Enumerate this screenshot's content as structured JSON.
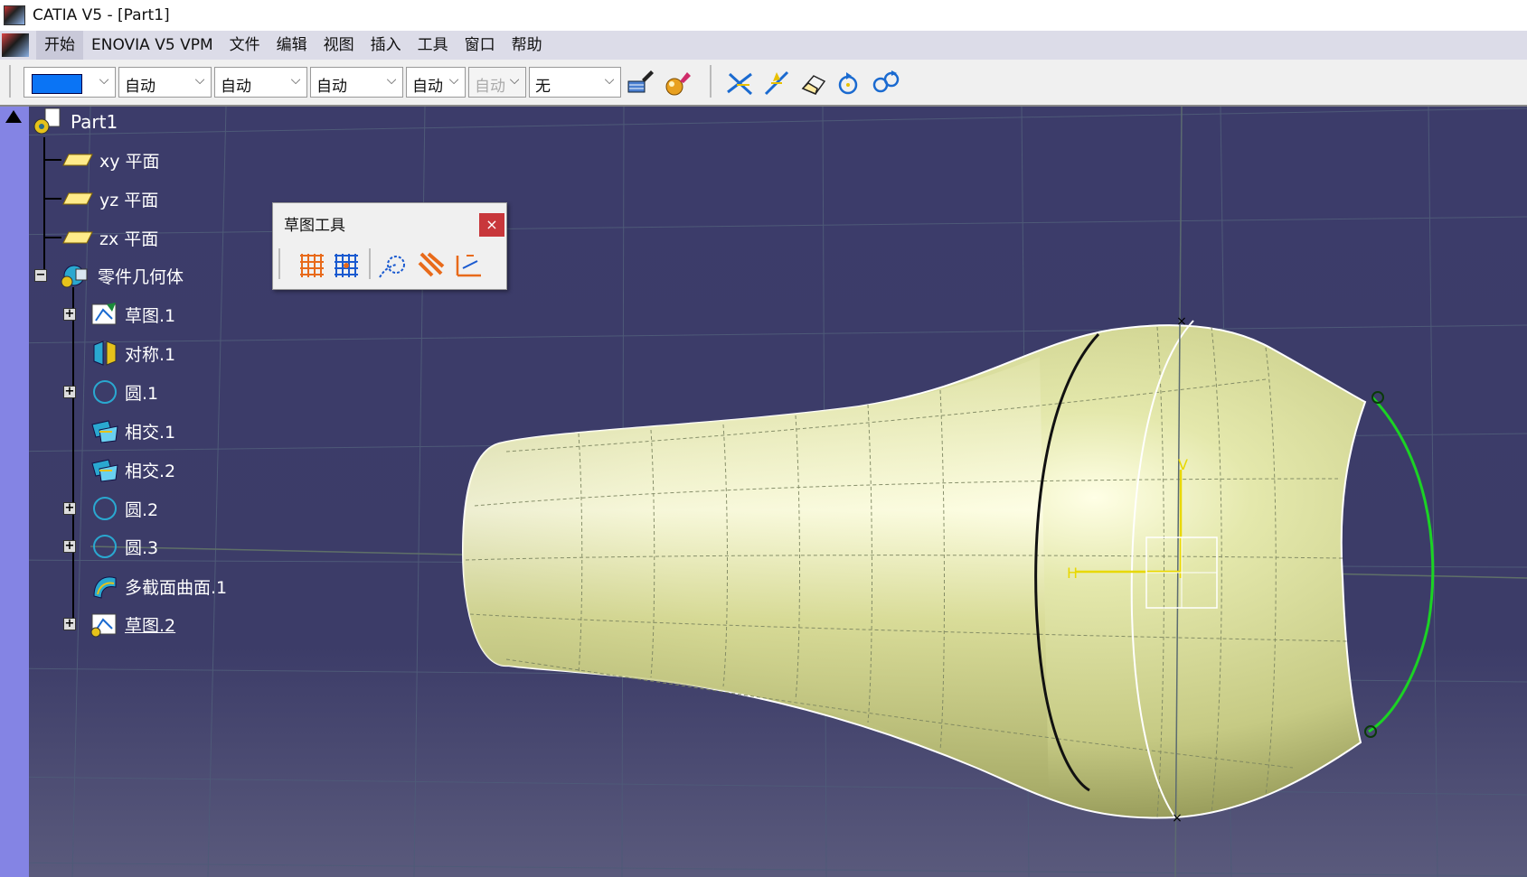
{
  "window": {
    "title": "CATIA V5 - [Part1]"
  },
  "menu": {
    "items": [
      "开始",
      "ENOVIA V5 VPM",
      "文件",
      "编辑",
      "视图",
      "插入",
      "工具",
      "窗口",
      "帮助"
    ]
  },
  "toolbar": {
    "color_value": "",
    "combo1": "自动",
    "combo2": "自动",
    "combo3": "自动",
    "combo4": "自动",
    "combo5": "自动",
    "combo6": "无",
    "accent_color": "#0a74f5"
  },
  "tree": {
    "root": "Part1",
    "xy": "xy 平面",
    "yz": "yz 平面",
    "zx": "zx 平面",
    "body": "零件几何体",
    "items": [
      "草图.1",
      "对称.1",
      "圆.1",
      "相交.1",
      "相交.2",
      "圆.2",
      "圆.3",
      "多截面曲面.1",
      "草图.2"
    ]
  },
  "floating_toolbar": {
    "title": "草图工具",
    "close": "×"
  }
}
